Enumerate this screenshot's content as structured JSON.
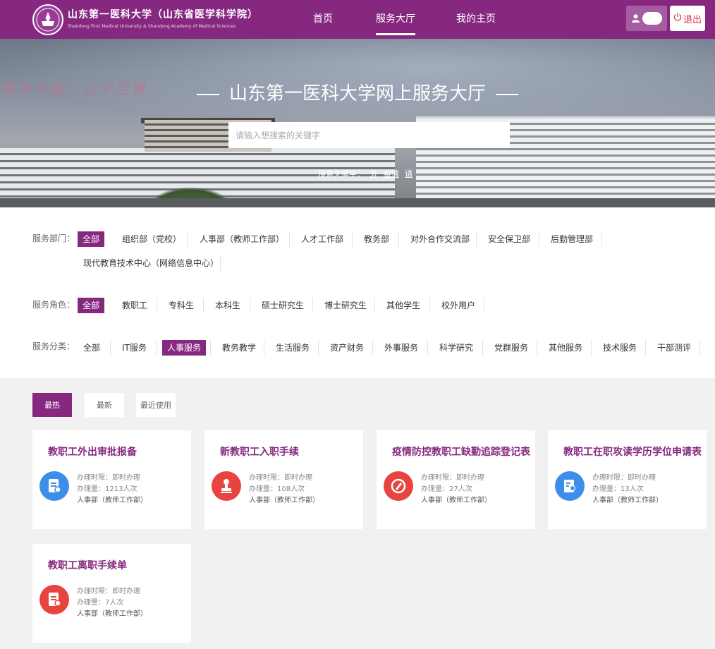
{
  "header": {
    "brand_cn": "山东第一医科大学（山东省医学科学院）",
    "brand_en": "Shandong First Medical University & Shandong Academy of Medical Sciences",
    "nav": [
      "首页",
      "服务大厅",
      "我的主页"
    ],
    "active_nav": "服务大厅",
    "logout_label": "退出",
    "user_icon": "user-icon",
    "logout_icon": "power-icon"
  },
  "banner": {
    "motto": "路步千里，止于至善",
    "title": "山东第一医科大学网上服务大厅",
    "search_placeholder": "请输入想搜索的关键字",
    "keywords_label": "搜索关键字：",
    "keywords": [
      "外",
      "疫情",
      "请"
    ]
  },
  "filters": {
    "department": {
      "label": "服务部门：",
      "options": [
        "全部",
        "组织部（党校）",
        "人事部（教师工作部）",
        "人才工作部",
        "教务部",
        "对外合作交流部",
        "安全保卫部",
        "后勤管理部",
        "现代教育技术中心（网络信息中心）"
      ],
      "selected": "全部"
    },
    "role": {
      "label": "服务角色：",
      "options": [
        "全部",
        "教职工",
        "专科生",
        "本科生",
        "硕士研究生",
        "博士研究生",
        "其他学生",
        "校外用户"
      ],
      "selected": "全部"
    },
    "category": {
      "label": "服务分类：",
      "options": [
        "全部",
        "IT服务",
        "人事服务",
        "教务教学",
        "生活服务",
        "资产财务",
        "外事服务",
        "科学研究",
        "党群服务",
        "其他服务",
        "技术服务",
        "干部测评"
      ],
      "selected": "人事服务"
    }
  },
  "sort_tabs": [
    "最热",
    "最新",
    "最近使用"
  ],
  "sort_selected": "最热",
  "cards": [
    {
      "title": "教职工外出审批报备",
      "time": "办理时限：即时办理",
      "count": "办理量：1213人次",
      "dept": "人事部（教师工作部）",
      "icon": "document-edit-icon",
      "color": "#3d8ee8"
    },
    {
      "title": "新教职工入职手续",
      "time": "办理时限：即时办理",
      "count": "办理量：108人次",
      "dept": "人事部（教师工作部）",
      "icon": "stamp-icon",
      "color": "#e8443f"
    },
    {
      "title": "疫情防控教职工缺勤追踪登记表",
      "time": "办理时限：即时办理",
      "count": "办理量：27人次",
      "dept": "人事部（教师工作部）",
      "icon": "pen-icon",
      "color": "#e8443f"
    },
    {
      "title": "教职工在职攻读学历学位申请表",
      "time": "办理时限：即时办理",
      "count": "办理量：13人次",
      "dept": "人事部（教师工作部）",
      "icon": "certificate-icon",
      "color": "#3d8ee8"
    },
    {
      "title": "教职工离职手续单",
      "time": "办理时限：即时办理",
      "count": "办理量：7人次",
      "dept": "人事部（教师工作部）",
      "icon": "document-edit-icon",
      "color": "#e8443f"
    }
  ]
}
